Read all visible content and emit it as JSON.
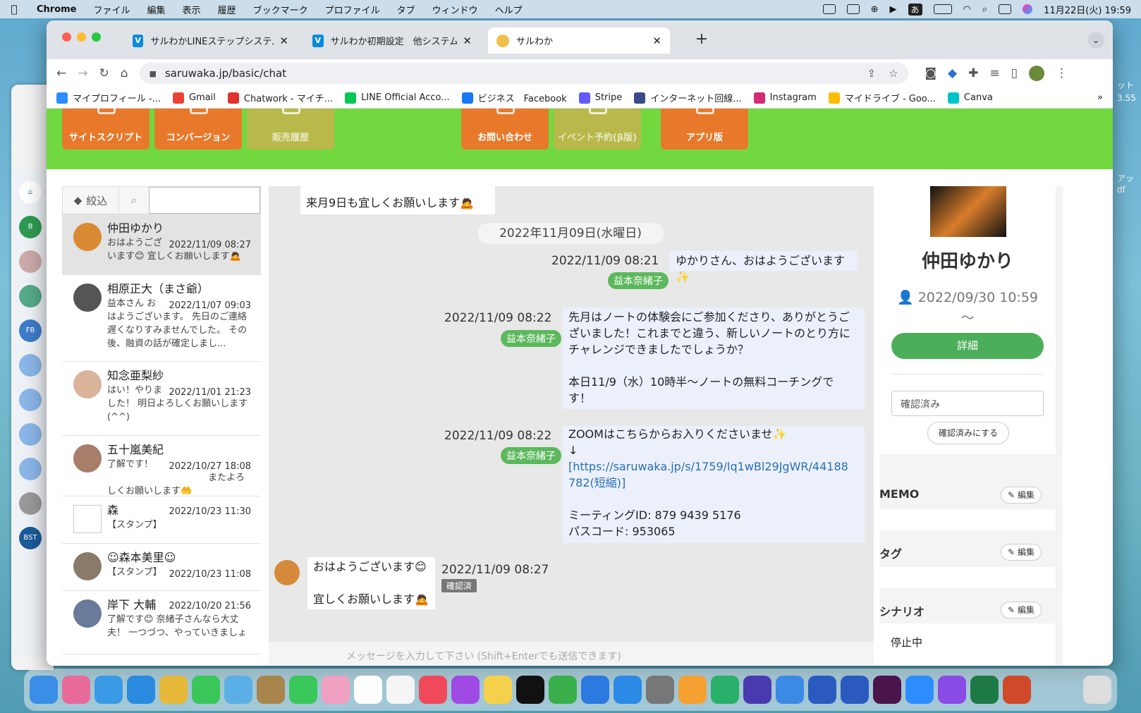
{
  "menubar": {
    "app": "Chrome",
    "items": [
      "ファイル",
      "編集",
      "表示",
      "履歴",
      "ブックマーク",
      "プロファイル",
      "タブ",
      "ウィンドウ",
      "ヘルプ"
    ],
    "ime": "あ",
    "clock": "11月22日(火)  19:59"
  },
  "tabs": [
    {
      "title": "サルわかLINEステップシステム〜L"
    },
    {
      "title": "サルわか初期設定　他システムから"
    },
    {
      "title": "サルわか"
    }
  ],
  "url": "saruwaka.jp/basic/chat",
  "bookmarks": [
    {
      "label": "マイプロフィール -...",
      "color": "#2d8cff"
    },
    {
      "label": "Gmail",
      "color": "#ea4335"
    },
    {
      "label": "Chatwork - マイチ...",
      "color": "#e0322e"
    },
    {
      "label": "LINE Official Acco...",
      "color": "#06c755"
    },
    {
      "label": "ビジネス　Facebook",
      "color": "#1877f2"
    },
    {
      "label": "Stripe",
      "color": "#635bff"
    },
    {
      "label": "インターネット回線...",
      "color": "#3a4a8a"
    },
    {
      "label": "Instagram",
      "color": "#d62976"
    },
    {
      "label": "マイドライブ - Goo...",
      "color": "#fbbc04"
    },
    {
      "label": "Canva",
      "color": "#00c4cc"
    }
  ],
  "bookmarks_more": "»",
  "nav": [
    "サイトスクリプト",
    "コンバージョン",
    "販売履歴",
    "お問い合わせ",
    "イベント予約(β版)",
    "アプリ版"
  ],
  "list": {
    "filter_label": "絞込",
    "conversations": [
      {
        "name": "仲田ゆかり",
        "time": "2022/11/09 08:27",
        "preview": "おはようござ　　　　　　　　　　　います😊 宜しくお願いします🙇"
      },
      {
        "name": "相原正大（まさ爺）",
        "time": "2022/11/07 09:03",
        "preview": "益本さん お　　　　　　　　　　　はようございます。 先日のご連絡遅くなりすみませんでした。 その後、融資の話が確定しまし..."
      },
      {
        "name": "知念亜梨紗",
        "time": "2022/11/01 21:23",
        "preview": "はい！やりま　　　　　　　　　　　した！ 明日よろしくお願いします(^^)"
      },
      {
        "name": "五十嵐美紀",
        "time": "2022/10/27 18:08",
        "preview": "了解です！ 　　　　　　　　　　　またよろしくお願いします🤲"
      },
      {
        "name": "森",
        "time": "2022/10/23 11:30",
        "preview": "【スタンプ】"
      },
      {
        "name": "☺森本美里☺",
        "time": "2022/10/23 11:08",
        "preview": "【スタンプ】"
      },
      {
        "name": "岸下 大輔",
        "time": "2022/10/20 21:56",
        "preview": "了解です😊 奈緒子さんなら大丈夫！ 一つづつ、やっていきましょ"
      }
    ]
  },
  "chat": {
    "prev_message": "来月9日も宜しくお願いします🙇",
    "date_label": "2022年11月09日(水曜日)",
    "messages": [
      {
        "time": "2022/11/09 08:21",
        "sender": "益本奈緒子",
        "text": "ゆかりさん、おはようございます✨"
      },
      {
        "time": "2022/11/09 08:22",
        "sender": "益本奈緒子",
        "lines": [
          "先月はノートの体験会にご参加くださり、ありがとうご",
          "ざいました！これまでと違う、新しいノートのとり方に",
          "チャレンジできましたでしょうか？",
          "",
          "本日11/9（水）10時半〜ノートの無料コーチングで",
          "す！"
        ]
      },
      {
        "time": "2022/11/09 08:22",
        "sender": "益本奈緒子",
        "line1": "ZOOMはこちらからお入りくださいませ✨",
        "arrow": "↓",
        "link1": "[https://saruwaka.jp/s/1759/lq1wBl29JgWR/44188",
        "link2": "782(短縮)]",
        "id_line": "ミーティングID: 879 9439 5176",
        "pass_line": "パスコード: 953065"
      }
    ],
    "reply": {
      "line1": "おはようございます😊",
      "line2": "宜しくお願いします🙇",
      "time": "2022/11/09 08:27",
      "badge": "確認済"
    },
    "input_placeholder": "メッセージを入力して下さい (Shift+Enterでも送信できます)"
  },
  "profile": {
    "name": "仲田ゆかり",
    "date": "2022/09/30 10:59",
    "tilde": "〜",
    "detail_label": "詳細",
    "status": "確認済み",
    "confirm_label": "確認済みにする",
    "memo_title": "MEMO",
    "tag_title": "タグ",
    "scenario_title": "シナリオ",
    "edit_label": "編集",
    "scenario_value": "停止中"
  },
  "desktop_right_text": [
    "ット",
    "3.55",
    "アッ",
    "df"
  ]
}
